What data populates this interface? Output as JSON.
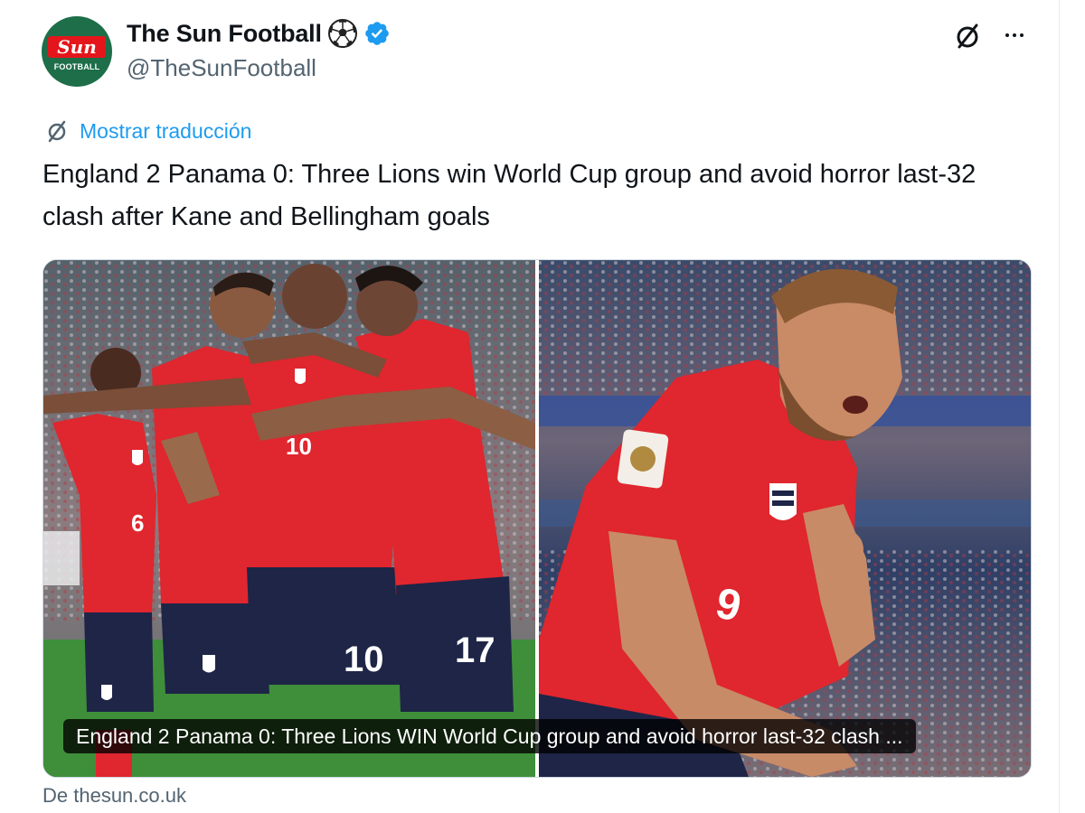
{
  "account": {
    "display_name": "The Sun Football",
    "handle": "@TheSunFootball",
    "verified": true,
    "avatar_logo_text": "Sun",
    "avatar_logo_subtext": "FOOTBALL"
  },
  "actions": {
    "grok_icon": "grok-slash-icon",
    "more_icon": "more-horizontal-icon"
  },
  "translation": {
    "label": "Mostrar traducción"
  },
  "tweet": {
    "text": "England 2 Panama 0: Three Lions win World Cup group and avoid horror last-32 clash after Kane and Bellingham goals"
  },
  "media": {
    "caption": "England 2 Panama 0: Three Lions WIN World Cup group and avoid horror last-32 clash ...",
    "left_shirt_numbers": [
      "6",
      "10",
      "10",
      "17"
    ],
    "right_shirt_number": "9"
  },
  "link_card": {
    "source": "De thesun.co.uk"
  },
  "colors": {
    "link_blue": "#1d9bf0",
    "handle_gray": "#536471",
    "shirt_red": "#e0262e",
    "shorts_navy": "#1e2547",
    "pitch_green": "#3f8f3a",
    "verified_blue": "#1d9bf0"
  }
}
